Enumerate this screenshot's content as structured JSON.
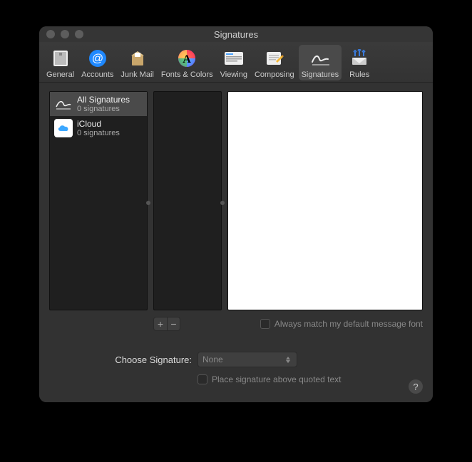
{
  "window": {
    "title": "Signatures"
  },
  "toolbar": {
    "general": "General",
    "accounts": "Accounts",
    "junk": "Junk Mail",
    "fonts": "Fonts & Colors",
    "viewing": "Viewing",
    "composing": "Composing",
    "signatures": "Signatures",
    "rules": "Rules"
  },
  "sources": {
    "all": {
      "label": "All Signatures",
      "count": "0 signatures"
    },
    "icloud": {
      "label": "iCloud",
      "count": "0 signatures"
    }
  },
  "buttons": {
    "add": "+",
    "remove": "−"
  },
  "options": {
    "match_font": "Always match my default message font",
    "choose_label": "Choose Signature:",
    "choose_value": "None",
    "place_above": "Place signature above quoted text"
  },
  "help": "?"
}
